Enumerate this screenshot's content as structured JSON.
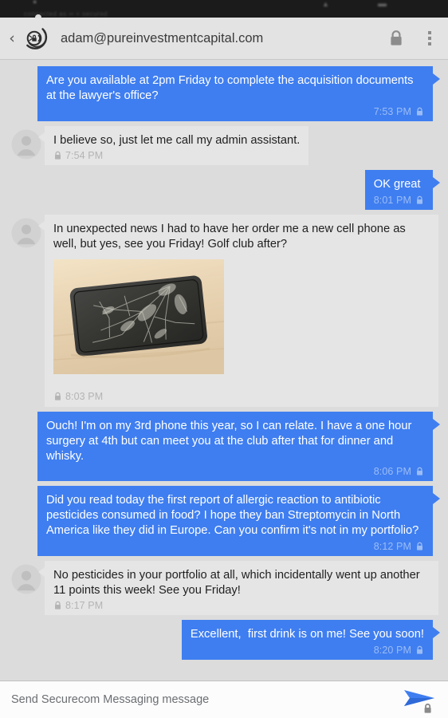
{
  "status_bar": {
    "ghost_text": "connected as ∞ = secured",
    "icons": [
      "signal-icon",
      "wifi-icon",
      "battery-icon"
    ]
  },
  "header": {
    "back_label": "‹",
    "logo_icon": "securecom-logo-icon",
    "title": "adam@pureinvestmentcapital.com",
    "lock_icon": "lock-icon",
    "overflow_icon": "overflow-menu-icon"
  },
  "colors": {
    "outgoing_bubble": "#3f7ef0",
    "incoming_bubble": "#e5e5e5",
    "thread_background": "#dcdcdc",
    "header_background": "#e3e3e3",
    "outgoing_text": "#ffffff",
    "incoming_text": "#1f1f1f",
    "outgoing_meta": "#9bbcf5",
    "incoming_meta": "#b4b4b4",
    "send_icon": "#3f7ef0"
  },
  "messages": [
    {
      "direction": "outgoing",
      "text": "Are you available at 2pm Friday to complete the acquisition documents at the lawyer's office?",
      "time": "7:53 PM",
      "lock_icon": "lock-icon",
      "has_avatar": false,
      "has_photo": false
    },
    {
      "direction": "incoming",
      "text": "I believe so, just let me call my admin assistant.",
      "time": "7:54 PM",
      "lock_icon": "lock-icon",
      "has_avatar": true,
      "avatar_icon": "contact-avatar-icon",
      "has_photo": false
    },
    {
      "direction": "outgoing",
      "text": "OK great",
      "time": "8:01 PM",
      "lock_icon": "lock-icon",
      "has_avatar": false,
      "has_photo": false
    },
    {
      "direction": "incoming",
      "text": "In unexpected news I had to have her order me a new cell phone as well, but yes, see you Friday! Golf club after?",
      "time": "8:03 PM",
      "lock_icon": "lock-icon",
      "has_avatar": true,
      "avatar_icon": "contact-avatar-icon",
      "has_photo": true,
      "photo_alt": "photo of a black smartphone with a cracked screen on a light wooden table"
    },
    {
      "direction": "outgoing",
      "text": "Ouch! I'm on my 3rd phone this year, so I can relate. I have a one hour surgery at 4th but can meet you at the club after that for dinner and whisky.",
      "time": "8:06 PM",
      "lock_icon": "lock-icon",
      "has_avatar": false,
      "has_photo": false
    },
    {
      "direction": "outgoing",
      "text": "Did you read today the first report of allergic reaction to antibiotic pesticides consumed in food? I hope they ban Streptomycin in North America like they did in Europe. Can you confirm it's not in my portfolio?",
      "time": "8:12 PM",
      "lock_icon": "lock-icon",
      "has_avatar": false,
      "has_photo": false
    },
    {
      "direction": "incoming",
      "text": "No pesticides in your portfolio at all, which incidentally went up another 11 points this week! See you Friday!",
      "time": "8:17 PM",
      "lock_icon": "lock-icon",
      "has_avatar": true,
      "avatar_icon": "contact-avatar-icon",
      "has_photo": false
    },
    {
      "direction": "outgoing",
      "text": "Excellent,  first drink is on me! See you soon!",
      "time": "8:20 PM",
      "lock_icon": "lock-icon",
      "has_avatar": false,
      "has_photo": false
    }
  ],
  "composer": {
    "placeholder": "Send Securecom Messaging message",
    "value": "",
    "send_icon": "send-secure-icon"
  }
}
